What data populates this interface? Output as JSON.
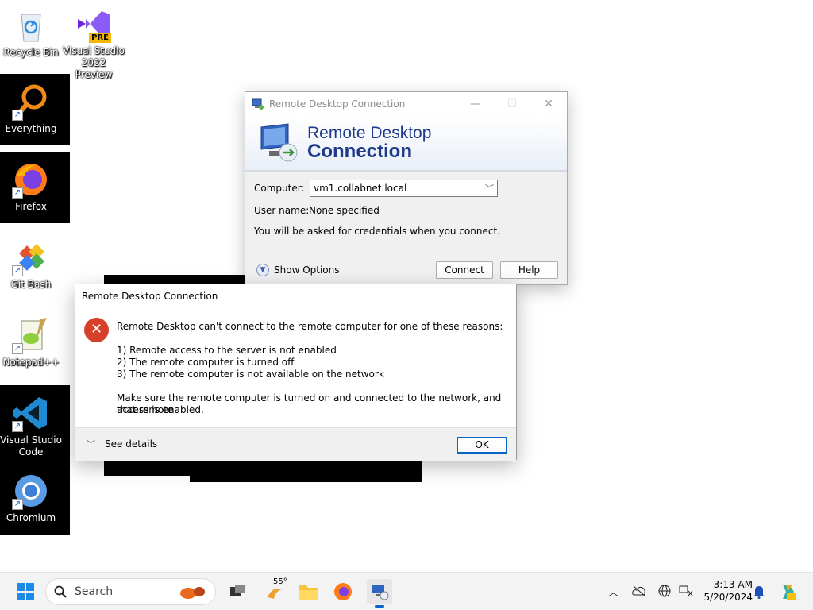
{
  "desktop": {
    "icons": [
      {
        "label": "Recycle Bin"
      },
      {
        "label": "Visual Studio 2022 Preview",
        "badge": "PRE"
      },
      {
        "label": "Everything"
      },
      {
        "label": "Firefox"
      },
      {
        "label": "Git Bash"
      },
      {
        "label": "Notepad++"
      },
      {
        "label": "Visual Studio Code"
      },
      {
        "label": "Chromium"
      }
    ]
  },
  "rdc": {
    "title": "Remote Desktop Connection",
    "banner_line1": "Remote Desktop",
    "banner_line2": "Connection",
    "computer_label": "Computer:",
    "computer_value": "vm1.collabnet.local",
    "username_label": "User name:",
    "username_value": "None specified",
    "credentials_note": "You will be asked for credentials when you connect.",
    "show_options": "Show Options",
    "connect": "Connect",
    "help": "Help"
  },
  "error": {
    "title": "Remote Desktop Connection",
    "message": "Remote Desktop can't connect to the remote computer for one of these reasons:",
    "reasons": [
      "1) Remote access to the server is not enabled",
      "2) The remote computer is turned off",
      "3) The remote computer is not available on the network"
    ],
    "advice_line1": "Make sure the remote computer is turned on and connected to the network, and that remote",
    "advice_line2": "access is enabled.",
    "see_details": "See details",
    "ok": "OK"
  },
  "taskbar": {
    "search_label": "Search",
    "weather_temp": "55°",
    "time": "3:13 AM",
    "date": "5/20/2024"
  },
  "colors": {
    "accent": "#0a64c8",
    "error_red": "#d6402b",
    "banner_text": "#1e3a8a"
  }
}
